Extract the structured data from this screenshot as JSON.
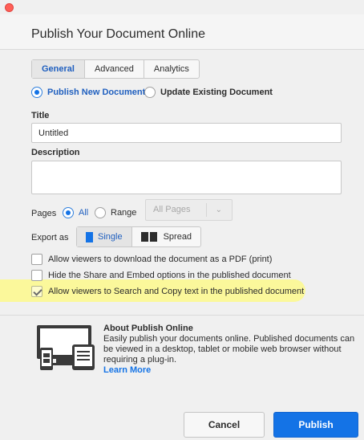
{
  "dialog": {
    "title": "Publish Your Document Online"
  },
  "tabs": [
    {
      "label": "General",
      "active": true
    },
    {
      "label": "Advanced",
      "active": false
    },
    {
      "label": "Analytics",
      "active": false
    }
  ],
  "publish_mode": {
    "new_label": "Publish New Document",
    "existing_label": "Update Existing Document",
    "selected": "new"
  },
  "title_field": {
    "label": "Title",
    "value": "Untitled"
  },
  "description_field": {
    "label": "Description",
    "value": ""
  },
  "pages": {
    "label": "Pages",
    "all_label": "All",
    "range_label": "Range",
    "selected": "all",
    "dropdown_value": "All Pages"
  },
  "export_as": {
    "label": "Export as",
    "single_label": "Single",
    "spread_label": "Spread",
    "selected": "single"
  },
  "options": [
    {
      "label": "Allow viewers to download the document as a PDF (print)",
      "checked": false
    },
    {
      "label": "Hide the Share and Embed options in the published document",
      "checked": false
    },
    {
      "label": "Allow viewers to Search and Copy text in the published document",
      "checked": true
    }
  ],
  "about": {
    "title": "About Publish Online",
    "text": "Easily publish your documents online. Published documents can be viewed in a desktop, tablet or mobile web browser without requiring a plug-in.",
    "learn_more": "Learn More",
    "icon": "devices-icon"
  },
  "buttons": {
    "cancel": "Cancel",
    "publish": "Publish"
  },
  "colors": {
    "accent": "#1473e6",
    "highlight": "#fbf896"
  }
}
